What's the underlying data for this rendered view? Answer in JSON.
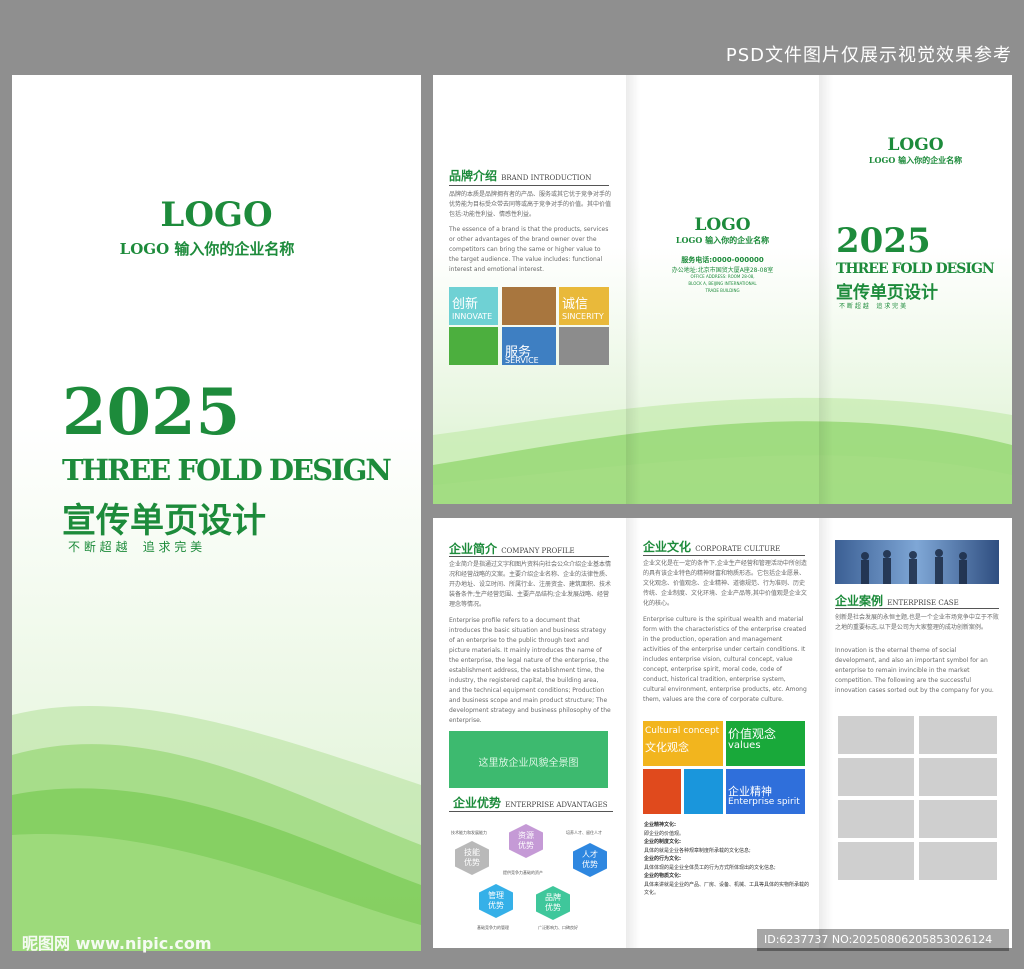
{
  "watermark_top": "PSD文件图片仅展示视觉效果参考",
  "watermark_bottom_left": "昵图网 www.nipic.com",
  "watermark_bottom_right": "ID:6237737 NO:20250806205853026124",
  "cover": {
    "logo": "LOGO",
    "company": "LOGO 输入你的企业名称",
    "year": "2025",
    "title_en": "THREE FOLD DESIGN",
    "title_cn": "宣传单页设计",
    "slogan": "不 断 超 越    追 求 完 美"
  },
  "brand": {
    "title": "品牌介绍",
    "title_en": "BRAND INTRODUCTION",
    "text_cn": "品牌的本质是品牌拥有者的产品、服务或其它优于竞争对手的优势能为目标受众带去同等或高于竞争对手的价值。其中价值包括:功能性利益、情感性利益。",
    "text_en": "The essence of a brand is that the products, services or other advantages of the brand owner over the competitors can bring the same or higher value to the target audience. The value includes: functional interest and emotional interest.",
    "tiles": [
      {
        "cn": "创新",
        "en": "INNOVATE",
        "color": "#6fd1d4"
      },
      {
        "cn": "",
        "en": "",
        "color": "#a8763e"
      },
      {
        "cn": "诚信",
        "en": "SINCERITY",
        "color": "#e9b93a"
      },
      {
        "cn": "",
        "en": "",
        "color": "#4caf3e"
      },
      {
        "cn": "服务",
        "en": "SERVICE",
        "color": "#3e7fc2"
      },
      {
        "cn": "",
        "en": "",
        "color": "#8c8c8c"
      }
    ]
  },
  "contact": {
    "logo": "LOGO",
    "company": "LOGO 输入你的企业名称",
    "phone": "服务电话:0000-000000",
    "address": "办公地址:北京市国贸大厦A座28-08室",
    "address_en1": "OFFICE ADDRESS: ROOM 28-08,",
    "address_en2": "BLOCK A, BEIJING INTERNATIONAL",
    "address_en3": "TRADE BUILDING"
  },
  "cover2": {
    "logo": "LOGO",
    "company": "LOGO 输入你的企业名称",
    "year": "2025",
    "title_en": "THREE FOLD DESIGN",
    "title_cn": "宣传单页设计",
    "slogan": "不 断 超 越    追 求 完 美"
  },
  "profile": {
    "title": "企业简介",
    "title_en": "COMPANY PROFILE",
    "text_cn": "企业简介是指通过文字和图片资料向社会公众介绍企业基本情况和经营战略的文案。主要介绍企业名称、企业的法律性质、开办地址、设立时间、所属行业、注册资金、建筑面积、技术装备条件;生产经营范围、主要产品结构;企业发展战略、经营理念等情况。",
    "text_en": "Enterprise profile refers to a document that introduces the basic situation and business strategy of an enterprise to the public through text and picture materials. It mainly introduces the name of the enterprise, the legal nature of the enterprise, the establishment address, the establishment time, the industry, the registered capital, the building area, and the technical equipment conditions; Production and business scope and main product structure; The development strategy and business philosophy of the enterprise.",
    "image_label": "这里放企业风貌全景图"
  },
  "advantages": {
    "title": "企业优势",
    "title_en": "ENTERPRISE ADVANTAGES",
    "note1": "技术能力和发展能力",
    "note2": "培养人才、留住人才",
    "note3": "提供竞争力基础的资产",
    "note4": "基础竞争力的管理",
    "note5": "广泛影响力、口碑良好",
    "hexes": [
      {
        "label": "技能\n优势",
        "color": "#b9b9b9"
      },
      {
        "label": "资源\n优势",
        "color": "#c59ad6"
      },
      {
        "label": "人才\n优势",
        "color": "#2e87e0"
      },
      {
        "label": "管理\n优势",
        "color": "#35b0e8"
      },
      {
        "label": "品牌\n优势",
        "color": "#3fc79b"
      }
    ]
  },
  "culture": {
    "title": "企业文化",
    "title_en": "CORPORATE CULTURE",
    "text_cn": "企业文化是在一定的条件下,企业生产经营和管理活动中所创造的具有该企业特色的精神财富和物质形态。它包括企业愿景、文化观念、价值观念、企业精神、道德规范、行为准则、历史传统、企业制度、文化环境、企业产品等,其中价值观是企业文化的核心。",
    "text_en": "Enterprise culture is the spiritual wealth and material form with the characteristics of the enterprise created in the production, operation and management activities of the enterprise under certain conditions. It includes enterprise vision, cultural concept, value concept, enterprise spirit, moral code, code of conduct, historical tradition, enterprise system, cultural environment, enterprise products, etc. Among them, values are the core of corporate culture.",
    "tiles": [
      {
        "cn": "文化观念",
        "en": "Cultural concept",
        "color": "#f2b51e"
      },
      {
        "cn": "价值观念",
        "en": "values",
        "color": "#19a93a"
      },
      {
        "cn": "",
        "en": "",
        "color": "#e04a1d"
      },
      {
        "cn": "",
        "en": "",
        "color": "#1a96dc"
      },
      {
        "cn": "企业精神",
        "en": "Enterprise spirit",
        "color": "#2f6fdb"
      }
    ],
    "items": [
      {
        "label": "企业精神文化:",
        "text": "即企业的价值观。"
      },
      {
        "label": "企业的制度文化:",
        "text": "具体的就是企业各种规章制度所承载的文化信息;"
      },
      {
        "label": "企业的行为文化:",
        "text": "具体体现的是企业全体员工的行为方式所体现出的文化信息;"
      },
      {
        "label": "企业的物质文化:",
        "text": "具体来讲就是企业的产品、厂房、设备、机械、工具等具体的实物所承载的文化。"
      }
    ]
  },
  "cases": {
    "title": "企业案例",
    "title_en": "ENTERPRISE CASE",
    "text_cn": "创新是社会发展的永恒主题,也是一个企业市场竞争中立于不败之地的重要标志,以下是公司为大家整理的成功创新案例。",
    "text_en": "Innovation is the eternal theme of social development, and also an important symbol for an enterprise to remain invincible in the market competition. The following are the successful innovation cases sorted out by the company for you."
  }
}
